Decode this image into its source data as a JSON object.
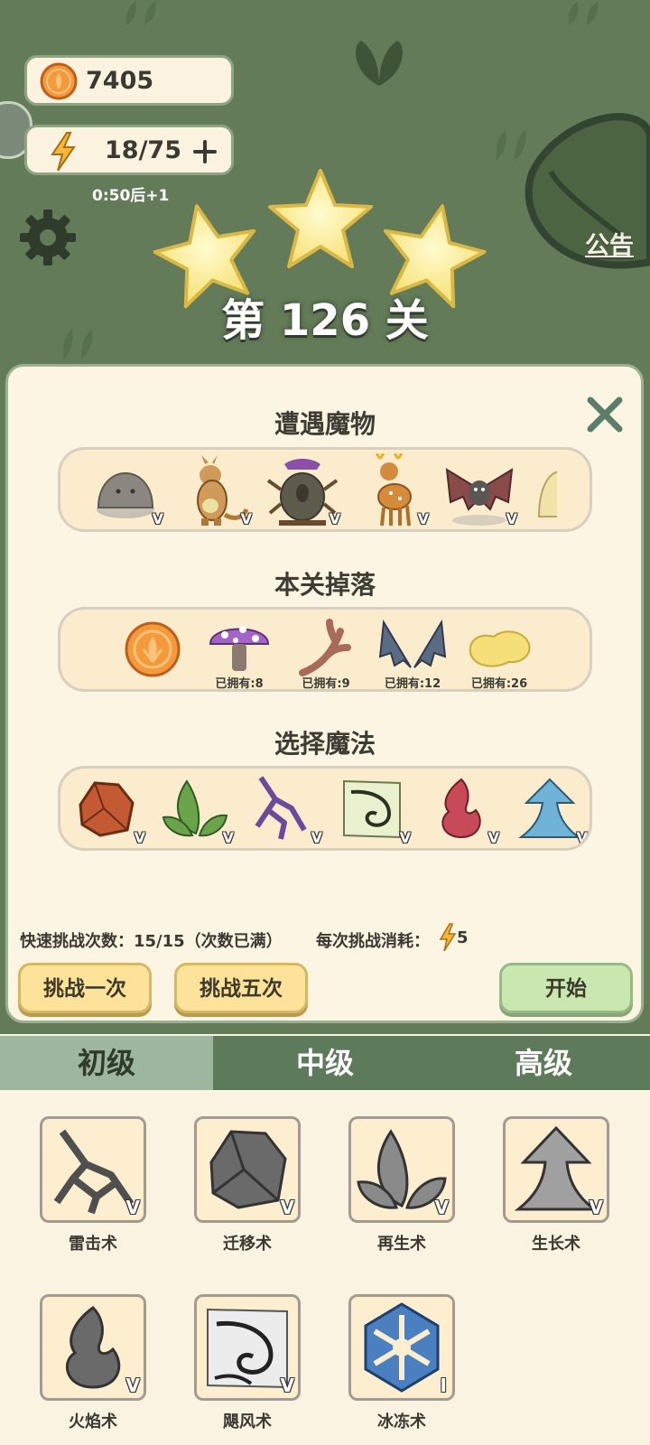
{
  "hud": {
    "coins": "7405",
    "energy": "18/75",
    "energy_timer": "0:50后+1",
    "notice_label": "公告"
  },
  "level": {
    "title": "第 126 关",
    "stars": 3
  },
  "panel": {
    "monsters_title": "遭遇魔物",
    "drops_title": "本关掉落",
    "magic_title": "选择魔法",
    "monsters": [
      {
        "name": "slime",
        "mark": "V"
      },
      {
        "name": "kangaroo",
        "mark": "V"
      },
      {
        "name": "tree-monster",
        "mark": "V"
      },
      {
        "name": "deer",
        "mark": "V"
      },
      {
        "name": "bat",
        "mark": "V"
      }
    ],
    "drops": [
      {
        "name": "coin",
        "owned": ""
      },
      {
        "name": "mushroom",
        "owned": "已拥有:8"
      },
      {
        "name": "antler",
        "owned": "已拥有:9"
      },
      {
        "name": "bat-wing",
        "owned": "已拥有:12"
      },
      {
        "name": "gold-nugget",
        "owned": "已拥有:26"
      }
    ],
    "magic": [
      {
        "name": "rock",
        "mark": "V"
      },
      {
        "name": "leaves",
        "mark": "V"
      },
      {
        "name": "lightning",
        "mark": "V"
      },
      {
        "name": "whirlwind",
        "mark": "V"
      },
      {
        "name": "fire",
        "mark": "V"
      },
      {
        "name": "grow",
        "mark": "V"
      }
    ],
    "quick_challenge": "快速挑战次数：15/15（次数已满）",
    "cost_label": "每次挑战消耗：",
    "cost_value": "5",
    "btn_once": "挑战一次",
    "btn_five": "挑战五次",
    "btn_start": "开始"
  },
  "tabs": [
    "初级",
    "中级",
    "高级"
  ],
  "active_tab": 0,
  "spells": [
    {
      "name": "雷击术",
      "mark": "V"
    },
    {
      "name": "迁移术",
      "mark": "V"
    },
    {
      "name": "再生术",
      "mark": "V"
    },
    {
      "name": "生长术",
      "mark": "V"
    },
    {
      "name": "火焰术",
      "mark": "V"
    },
    {
      "name": "飓风术",
      "mark": "V"
    },
    {
      "name": "冰冻术",
      "mark": "I"
    }
  ],
  "colors": {
    "grass": "#637b58",
    "panel": "#fdf5e4",
    "star": "#fff29a",
    "button_yellow": "#fde39a",
    "button_green": "#c8e8b0",
    "tab_active": "#9eb5a0",
    "tab_inactive": "#5d7a5a"
  }
}
